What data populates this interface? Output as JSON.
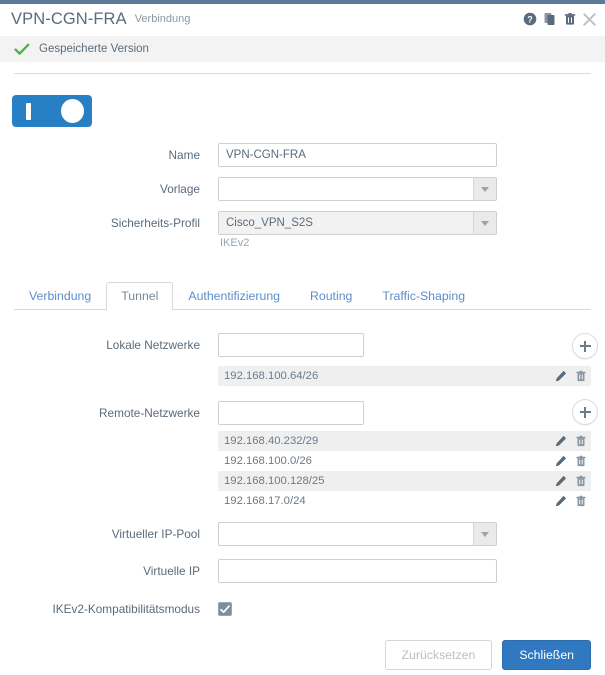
{
  "window": {
    "accent_color": "#5c7a99",
    "title": "VPN-CGN-FRA",
    "subtitle": "Verbindung",
    "icons": [
      {
        "name": "help-icon",
        "label": "Hilfe"
      },
      {
        "name": "copy-icon",
        "label": "Kopieren"
      },
      {
        "name": "trash-icon",
        "label": "Löschen"
      },
      {
        "name": "close-icon",
        "label": "Schließen"
      }
    ]
  },
  "status_banner": {
    "icon": "check-icon",
    "text": "Gespeicherte Version",
    "color": "#5cb85c"
  },
  "enable_toggle": {
    "state": "on",
    "color": "#2780c4"
  },
  "form": {
    "name": {
      "label": "Name",
      "value": "VPN-CGN-FRA",
      "placeholder": ""
    },
    "template": {
      "label": "Vorlage",
      "value": "",
      "placeholder": ""
    },
    "security_profile": {
      "label": "Sicherheits-Profil",
      "value": "Cisco_VPN_S2S",
      "hint": "IKEv2"
    }
  },
  "tabs": [
    {
      "label": "Verbindung",
      "active": false
    },
    {
      "label": "Tunnel",
      "active": true
    },
    {
      "label": "Authentifizierung",
      "active": false
    },
    {
      "label": "Routing",
      "active": false
    },
    {
      "label": "Traffic-Shaping",
      "active": false
    }
  ],
  "tunnel": {
    "local_networks": {
      "label": "Lokale Netzwerke",
      "input_value": "",
      "add_label": "+",
      "items": [
        "192.168.100.64/26"
      ]
    },
    "remote_networks": {
      "label": "Remote-Netzwerke",
      "input_value": "",
      "add_label": "+",
      "items": [
        "192.168.40.232/29",
        "192.168.100.0/26",
        "192.168.100.128/25",
        "192.168.17.0/24"
      ]
    },
    "virtual_ip_pool": {
      "label": "Virtueller IP-Pool",
      "value": ""
    },
    "virtual_ip": {
      "label": "Virtuelle IP",
      "value": "",
      "placeholder": ""
    },
    "ikev2_compat": {
      "label": "IKEv2-Kompatibilitätsmodus",
      "checked": true
    },
    "row_icons": {
      "edit": "pencil-icon",
      "delete": "trash-icon"
    }
  },
  "footer": {
    "reset_label": "Zurücksetzen",
    "close_label": "Schließen",
    "primary_color": "#3079c0"
  }
}
